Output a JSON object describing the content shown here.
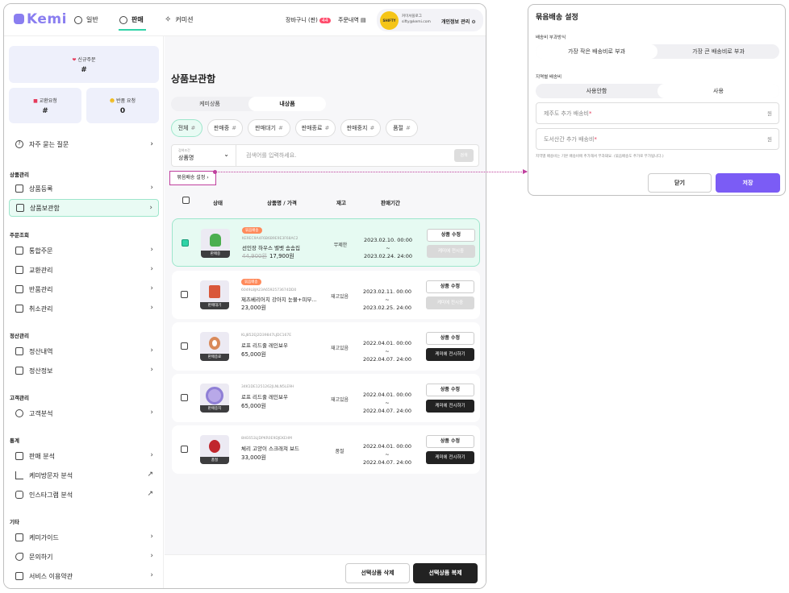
{
  "app": {
    "logo": "Kemi",
    "brand_color": "#8a7ef0",
    "accent_color": "#2fd3a6"
  },
  "topnav": {
    "tabs": [
      {
        "label": "일반",
        "icon": "gear-icon"
      },
      {
        "label": "판매",
        "icon": "target-icon"
      },
      {
        "label": "커미션",
        "icon": "sparkle-icon"
      }
    ],
    "active_tab": "판매",
    "cart_label": "장바구니 (판)",
    "cart_badge": "44",
    "orders_label": "주문내역",
    "user": {
      "avatar_text": "SHIFTY",
      "name": "커미셔블로그",
      "email": "sifty@kemi.com",
      "mypage_label": "개인정보 관리"
    }
  },
  "sidebar": {
    "stats": {
      "new_orders": {
        "label": "신규주문",
        "value": "#"
      },
      "exchange_requests": {
        "label": "교환요청",
        "value": "#"
      },
      "return_requests": {
        "label": "반품 요청",
        "value": "0"
      }
    },
    "faq_label": "자주 묻는 질문",
    "sections": [
      {
        "title": "상품관리",
        "items": [
          "상품등록",
          "상품보관함"
        ]
      },
      {
        "title": "주문조회",
        "items": [
          "통합주문",
          "교환관리",
          "반품관리",
          "취소관리"
        ]
      },
      {
        "title": "정산관리",
        "items": [
          "정산내역",
          "정산정보"
        ]
      },
      {
        "title": "고객관리",
        "items": [
          "고객분석"
        ]
      },
      {
        "title": "통계",
        "items": [
          "판매 분석",
          "케미방문자 분석",
          "인스타그램 분석"
        ]
      },
      {
        "title": "기타",
        "items": [
          "케미가이드",
          "문의하기",
          "서비스 이용약관"
        ]
      }
    ],
    "active_item": "상품보관함"
  },
  "main": {
    "title": "상품보관함",
    "tabs": [
      "케미상품",
      "내상품"
    ],
    "active_tab": "내상품",
    "filters": [
      "전체",
      "판매중",
      "판매대기",
      "판매종료",
      "판매중지",
      "품절"
    ],
    "active_filter": "전체",
    "search": {
      "select_caption": "검색조건",
      "select_value": "상품명",
      "placeholder": "검색어를 입력하세요.",
      "button": "검색"
    },
    "bundle_button": "묶음배송 설정",
    "table_headers": {
      "status": "상태",
      "name_price": "상품명 / 가격",
      "stock": "재고",
      "period": "판매기간"
    },
    "rows": [
      {
        "status": "판매중",
        "badge": "묶음배송",
        "code": "KE9EC9A4F6B6B9E9E3F68AC2",
        "name": "선인장 하우스 벨벳 솜솜집",
        "orig_price": "44,900원",
        "price": "17,900원",
        "stock": "무제한",
        "period_start": "2023.02.10. 00:00 ~",
        "period_end": "2023.02.24. 24:00",
        "edit": "상품 수정",
        "display": "케미에 전시중",
        "display_enabled": false,
        "checked": true
      },
      {
        "status": "판매대기",
        "badge": "묶음배송",
        "code": "6049L8JA23A6592573674DD0",
        "name": "제츠베리어치 강아지 눈물+피부...",
        "orig_price": "",
        "price": "23,000원",
        "stock": "재고있음",
        "period_start": "2023.02.11. 00:00 ~",
        "period_end": "2023.02.25. 24:00",
        "edit": "상품 수정",
        "display": "케미에 전시중",
        "display_enabled": false,
        "checked": false
      },
      {
        "status": "판매종료",
        "badge": "",
        "code": "KLJ852EJ2D39847LJDC167E",
        "name": "로프 리드줄 레인보우",
        "orig_price": "",
        "price": "65,000원",
        "stock": "재고있음",
        "period_start": "2022.04.01. 00:00 ~",
        "period_end": "2022.04.07. 24:00",
        "edit": "상품 수정",
        "display": "케미에 전시하기",
        "display_enabled": true,
        "checked": false
      },
      {
        "status": "판매중지",
        "badge": "",
        "code": "34K1DE1251262JLNLN5LE9H",
        "name": "로프 리드줄 레인보우",
        "orig_price": "",
        "price": "65,000원",
        "stock": "재고있음",
        "period_start": "2022.04.01. 00:00 ~",
        "period_end": "2022.04.07. 24:00",
        "edit": "상품 수정",
        "display": "케미에 전시하기",
        "display_enabled": true,
        "checked": false
      },
      {
        "status": "품절",
        "badge": "",
        "code": "8HE653LJDPKR0E9DJEKEHM",
        "name": "체리 고양이 스크래쳐 보드",
        "orig_price": "",
        "price": "33,000원",
        "stock": "품절",
        "period_start": "2022.04.01. 00:00 ~",
        "period_end": "2022.04.07. 24:00",
        "edit": "상품 수정",
        "display": "케미에 전시하기",
        "display_enabled": true,
        "checked": false
      }
    ],
    "footer": {
      "delete": "선택상품 삭제",
      "copy": "선택상품 복제"
    }
  },
  "modal": {
    "title": "묶음배송 설정",
    "method_label": "배송비 부과방식",
    "method_options": [
      "가장 작은 배송비로 부과",
      "가장 큰 배송비로 부과"
    ],
    "region_label": "지역별 배송비",
    "region_options": [
      "사용안함",
      "사용"
    ],
    "jeju_placeholder": "제주도 추가 배송비",
    "island_placeholder": "도서산간 추가 배송비",
    "currency": "원",
    "note": "지역별 배송비는 기본 배송비에 추가해서 부과돼요. (묶음배송도 추가로 부가됩니다.)",
    "close": "닫기",
    "save": "저장"
  }
}
